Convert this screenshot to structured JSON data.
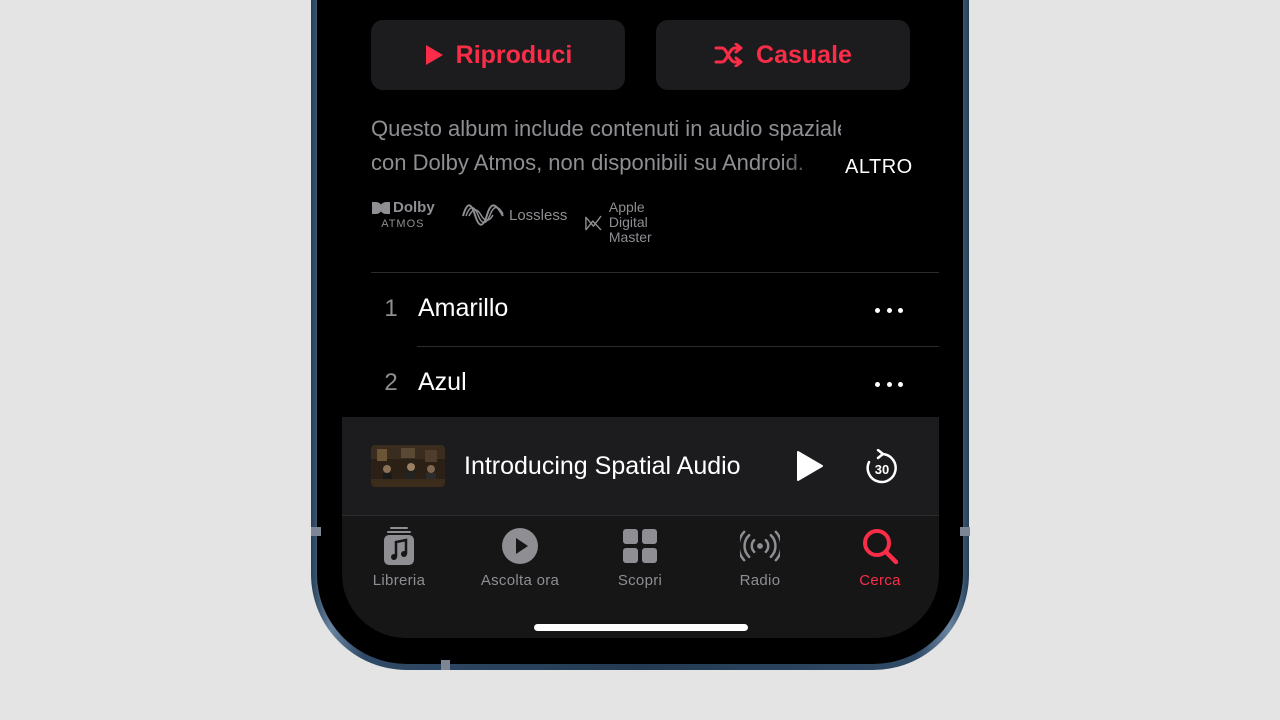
{
  "actions": {
    "play_label": "Riproduci",
    "shuffle_label": "Casuale"
  },
  "description": {
    "line1": "Questo album include contenuti in audio spaziale",
    "line2": "con Dolby Atmos, non disponibili su Android.",
    "more_label": "ALTRO"
  },
  "badges": {
    "dolby_top": "Dolby",
    "dolby_bottom": "ATMOS",
    "lossless": "Lossless",
    "adm_line1": "Apple",
    "adm_line2": "Digital Master"
  },
  "tracks": [
    {
      "number": "1",
      "title": "Amarillo"
    },
    {
      "number": "2",
      "title": "Azul"
    }
  ],
  "now_playing": {
    "title": "Introducing Spatial Audio",
    "skip_seconds": "30"
  },
  "tabs": [
    {
      "label": "Libreria",
      "icon": "library-icon",
      "active": false
    },
    {
      "label": "Ascolta ora",
      "icon": "listen-now-icon",
      "active": false
    },
    {
      "label": "Scopri",
      "icon": "browse-grid-icon",
      "active": false
    },
    {
      "label": "Radio",
      "icon": "radio-icon",
      "active": false
    },
    {
      "label": "Cerca",
      "icon": "search-icon",
      "active": true
    }
  ],
  "colors": {
    "accent": "#fa2d48",
    "secondary_text": "#8e8e93",
    "background": "#000000",
    "surface": "#1c1c1e"
  }
}
